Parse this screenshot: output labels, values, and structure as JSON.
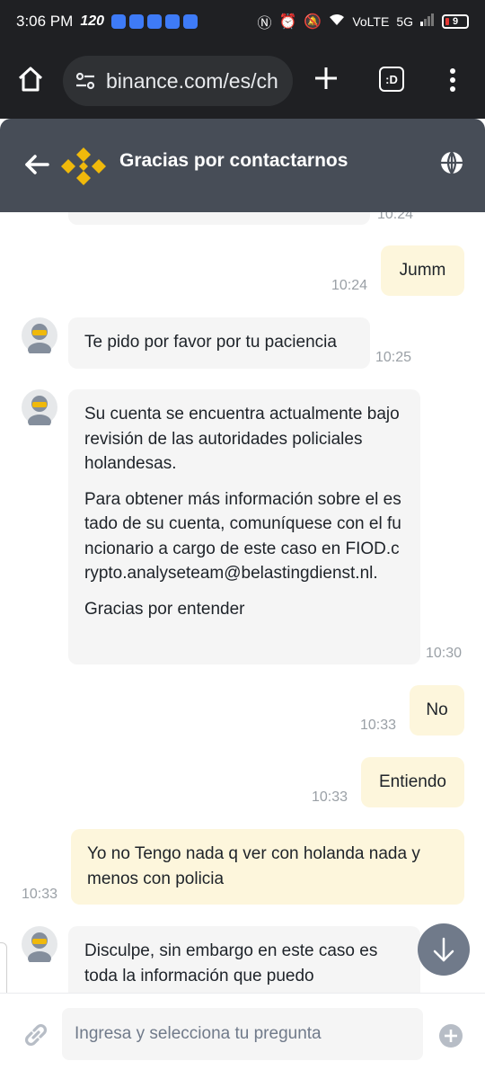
{
  "status_bar": {
    "time": "3:06 PM",
    "refresh_rate": "120",
    "network": "VoLTE",
    "signal": "5G",
    "battery": "9"
  },
  "browser": {
    "url": "binance.com/es/ch",
    "tabs_label": ":D"
  },
  "header": {
    "title": "Gracias por contactarnos"
  },
  "messages": {
    "top_partial_time": "10:24",
    "m1": {
      "text": "Jumm",
      "time": "10:24"
    },
    "m2": {
      "text": "Te pido por favor por tu paciencia",
      "time": "10:25"
    },
    "m3": {
      "p1": "Su cuenta se encuentra actualmente bajo revisión de las autoridades policiales holandesas.",
      "p2": "Para obtener más información sobre el estado de su cuenta, comuníquese con el funcionario a cargo de este caso en FIOD.crypto.analyseteam@belastingdienst.nl.",
      "p3": "Gracias por entender",
      "time": "10:30"
    },
    "m4": {
      "text": "No",
      "time": "10:33"
    },
    "m5": {
      "text": "Entiendo",
      "time": "10:33"
    },
    "m6": {
      "text": "Yo no Tengo nada q ver con holanda nada y menos con policia",
      "time": "10:33"
    },
    "m7": {
      "text": "Disculpe, sin embargo en este caso es toda la información que puedo"
    }
  },
  "input": {
    "placeholder": "Ingresa y selecciona tu pregunta"
  },
  "colors": {
    "header_bg": "#474d57",
    "brand_yellow": "#f0b90b",
    "user_bubble": "#fdf6dc",
    "agent_bubble": "#f5f5f5"
  }
}
